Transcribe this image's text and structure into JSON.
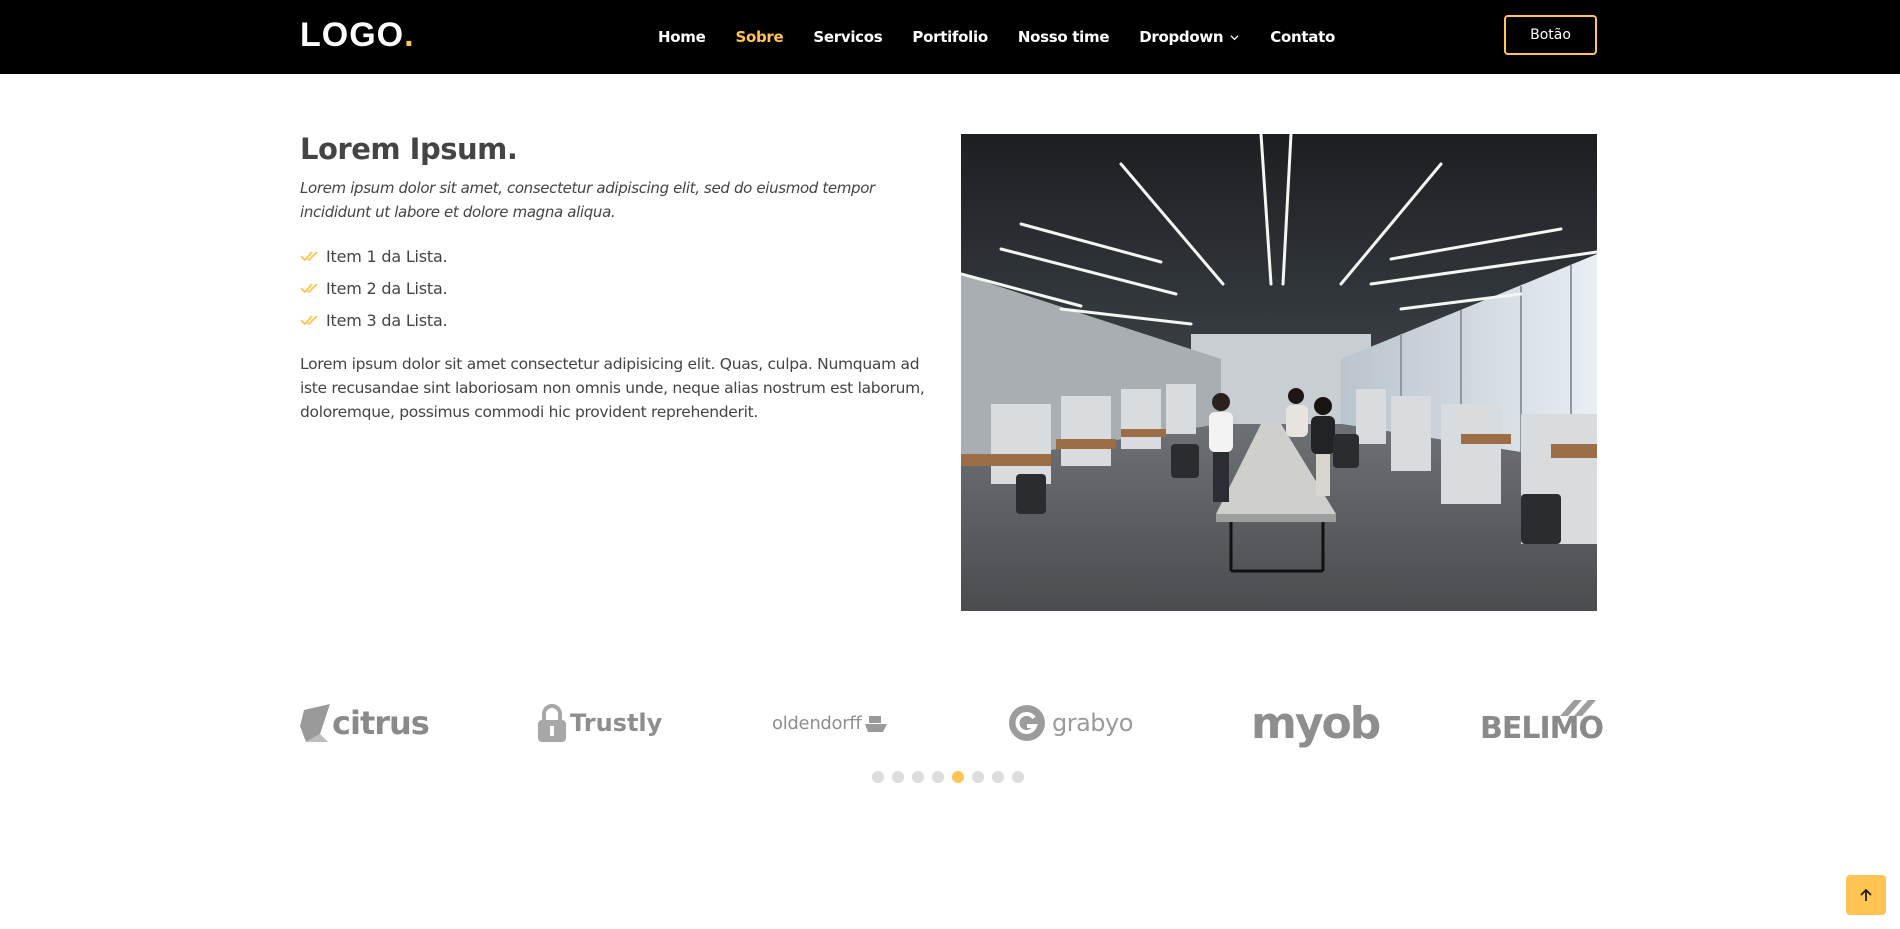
{
  "header": {
    "logo_text": "LOGO",
    "logo_dot": ".",
    "nav": [
      {
        "label": "Home",
        "active": false
      },
      {
        "label": "Sobre",
        "active": true
      },
      {
        "label": "Servicos",
        "active": false
      },
      {
        "label": "Portifolio",
        "active": false
      },
      {
        "label": "Nosso time",
        "active": false
      },
      {
        "label": "Dropdown",
        "active": false,
        "icon": "chevron-down-icon"
      },
      {
        "label": "Contato",
        "active": false
      }
    ],
    "button_label": "Botão"
  },
  "about": {
    "title": "Lorem Ipsum.",
    "lead": "Lorem ipsum dolor sit amet, consectetur adipiscing elit, sed do eiusmod tempor incididunt ut labore et dolore magna aliqua.",
    "list": [
      "Item 1 da Lista.",
      "Item 2 da Lista.",
      "Item 3 da Lista."
    ],
    "list_icon": "double-check-icon",
    "text": "Lorem ipsum dolor sit amet consectetur adipisicing elit. Quas, culpa. Numquam ad iste recusandae sint laboriosam non omnis unde, neque alias nostrum est laborum, doloremque, possimus commodi hic provident reprehenderit."
  },
  "clients": {
    "logos": [
      "citrus",
      "Trustly",
      "oldendorff",
      "grabyo",
      "myob",
      "BELIMO"
    ],
    "slide_count": 8,
    "active_slide": 4
  },
  "colors": {
    "accent": "#ffc451",
    "header_bg": "#000000",
    "text": "#444444",
    "logo_gray": "#8c8c8c"
  },
  "back_to_top_icon": "arrow-up-icon"
}
